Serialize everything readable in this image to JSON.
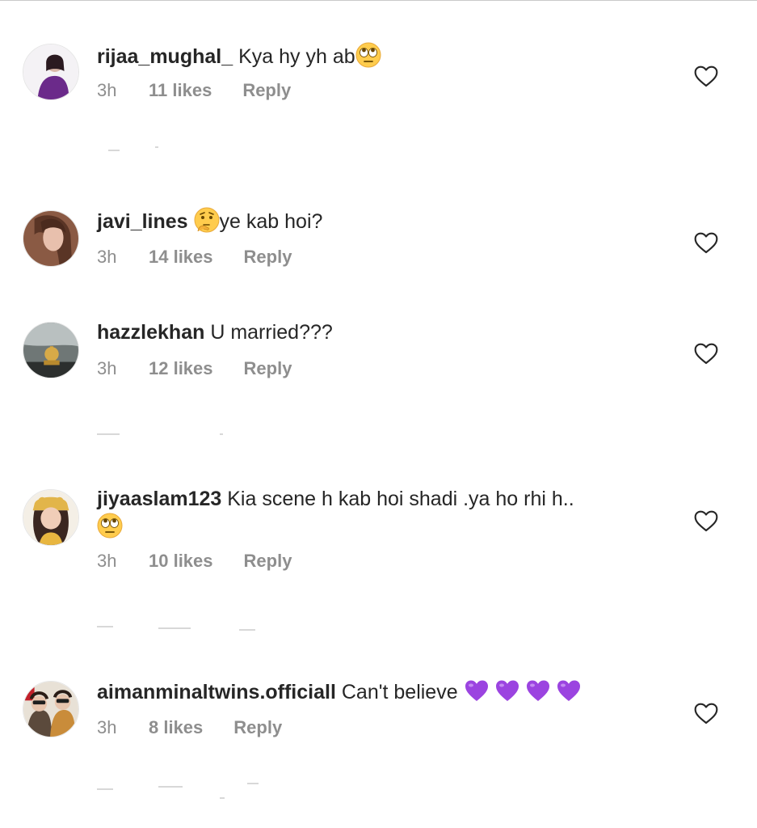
{
  "comments": [
    {
      "username": "rijaa_mughal_",
      "text": "Kya hy yh ab",
      "emoji_after": "face-with-rolling-eyes",
      "time": "3h",
      "likes": "11 likes",
      "reply": "Reply"
    },
    {
      "username": "javi_lines",
      "emoji_before": "thinking-face",
      "text": "ye kab hoi?",
      "time": "3h",
      "likes": "14 likes",
      "reply": "Reply"
    },
    {
      "username": "hazzlekhan",
      "text": "U married???",
      "time": "3h",
      "likes": "12 likes",
      "reply": "Reply"
    },
    {
      "username": "jiyaaslam123",
      "text": "Kia scene h kab hoi shadi .ya ho rhi h..",
      "emoji_next_line": "face-with-rolling-eyes",
      "time": "3h",
      "likes": "10 likes",
      "reply": "Reply"
    },
    {
      "username": "aimanminaltwins.officiall",
      "text": "Can't believe",
      "emoji_after": "purple-heart x4",
      "time": "3h",
      "likes": "8 likes",
      "reply": "Reply"
    }
  ],
  "colors": {
    "username": "#262626",
    "meta": "#8e8e8e",
    "heart_outline": "#262626",
    "purple_heart": "#9b44e0"
  }
}
